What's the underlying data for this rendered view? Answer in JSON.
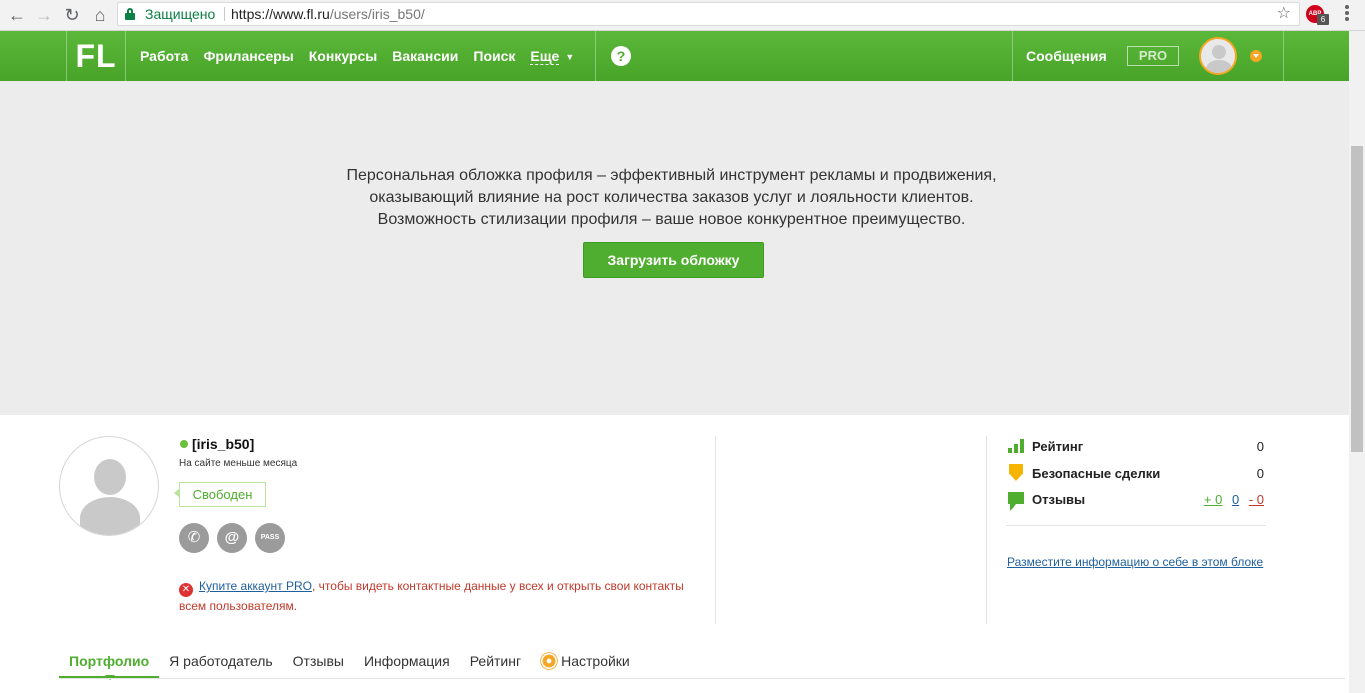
{
  "browser": {
    "secure_label": "Защищено",
    "url_host": "https://www.fl.ru",
    "url_path": "/users/iris_b50/",
    "ext_label": "ABP",
    "ext_badge": "6"
  },
  "header": {
    "logo": "FL",
    "nav": [
      "Работа",
      "Фрилансеры",
      "Конкурсы",
      "Вакансии",
      "Поиск"
    ],
    "more": "Еще",
    "help": "?",
    "messages": "Сообщения",
    "pro": "PRO"
  },
  "cover": {
    "line1": "Персональная обложка профиля – эффективный инструмент рекламы и продвижения,",
    "line2": "оказывающий влияние на рост количества заказов услуг и лояльности клиентов.",
    "line3": "Возможность стилизации профиля – ваше новое конкурентное преимущество.",
    "upload_button": "Загрузить обложку"
  },
  "profile": {
    "username": "[iris_b50]",
    "since": "На сайте меньше месяца",
    "status": "Свободен",
    "pass_label": "PASS",
    "warning_link": "Купите аккаунт PRO",
    "warning_text": ", чтобы видеть контактные данные у всех и открыть свои контакты всем пользователям."
  },
  "stats": {
    "rating_label": "Рейтинг",
    "rating_value": "0",
    "safe_label": "Безопасные сделки",
    "safe_value": "0",
    "reviews_label": "Отзывы",
    "reviews_pos": "+ 0",
    "reviews_neu": "0",
    "reviews_neg": "- 0",
    "about_link": "Разместите информацию о себе в этом блоке"
  },
  "tabs": [
    "Портфолио",
    "Я работодатель",
    "Отзывы",
    "Информация",
    "Рейтинг",
    "Настройки"
  ],
  "colors": {
    "brand_green": "#4fad2f",
    "accent_orange": "#f5a623",
    "link_blue": "#1f5f9c",
    "warning_red": "#c0392b"
  }
}
